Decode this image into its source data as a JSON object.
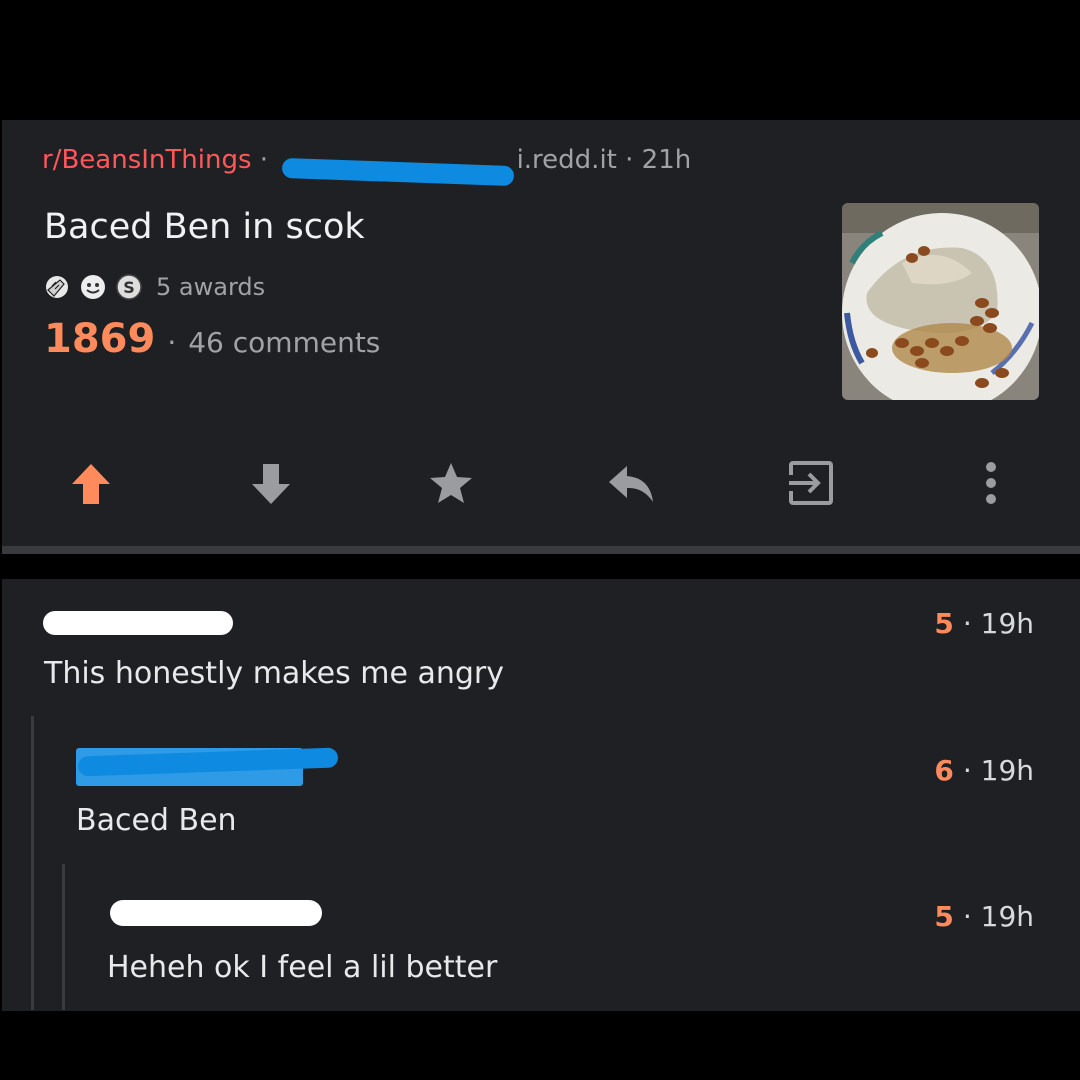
{
  "post": {
    "subreddit": "r/BeansInThings",
    "separator": "·",
    "domain": "i.redd.it",
    "age": "21h",
    "title": "Baced Ben in scok",
    "awards": {
      "icons": [
        "facepalm-award-icon",
        "wholesome-award-icon",
        "silver-coin-award-icon"
      ],
      "label": "5 awards"
    },
    "score": "1869",
    "comments_label": "46 comments",
    "thumbnail_icon": "food-photo-beans-plate",
    "accent_color": "#ff8a5c",
    "subreddit_color": "#ff585b"
  },
  "actions": [
    {
      "icon": "upvote-arrow-icon",
      "active": true
    },
    {
      "icon": "downvote-arrow-icon",
      "active": false
    },
    {
      "icon": "star-icon",
      "active": false
    },
    {
      "icon": "reply-icon",
      "active": false
    },
    {
      "icon": "share-exit-icon",
      "active": false
    },
    {
      "icon": "more-vertical-icon",
      "active": false
    }
  ],
  "comments": [
    {
      "score": "5",
      "age": "19h",
      "body": "This honestly makes me angry",
      "depth": 0
    },
    {
      "score": "6",
      "age": "19h",
      "body": "Baced Ben",
      "depth": 1
    },
    {
      "score": "5",
      "age": "19h",
      "body": "Heheh ok I feel a lil better",
      "depth": 2
    }
  ]
}
